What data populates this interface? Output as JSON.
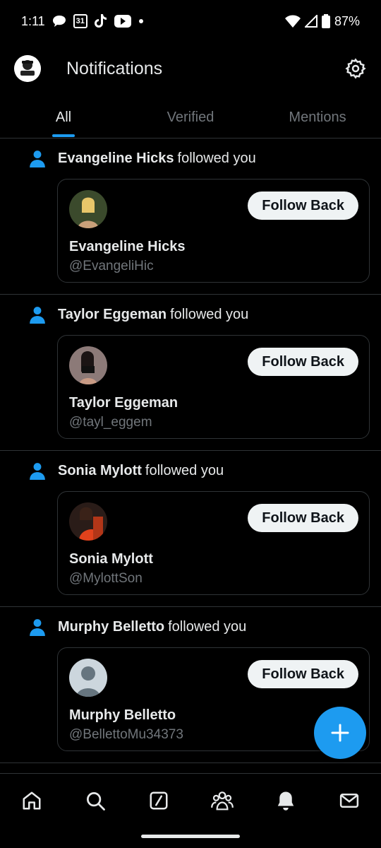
{
  "status_bar": {
    "time": "1:11",
    "battery": "87%",
    "calendar_day": "31",
    "left_icons": [
      "chat-bubble-icon",
      "calendar-icon",
      "tiktok-icon",
      "youtube-icon",
      "dot-icon"
    ],
    "right_icons": [
      "wifi-icon",
      "signal-icon",
      "battery-icon"
    ]
  },
  "header": {
    "title": "Notifications",
    "settings_icon": "gear-icon"
  },
  "tabs": [
    {
      "label": "All",
      "active": true
    },
    {
      "label": "Verified",
      "active": false
    },
    {
      "label": "Mentions",
      "active": false
    }
  ],
  "notifications": [
    {
      "name": "Evangeline Hicks",
      "action": "followed you",
      "card": {
        "name": "Evangeline Hicks",
        "handle": "@EvangeliHic",
        "button": "Follow Back"
      }
    },
    {
      "name": "Taylor Eggeman",
      "action": "followed you",
      "card": {
        "name": "Taylor Eggeman",
        "handle": "@tayl_eggem",
        "button": "Follow Back"
      }
    },
    {
      "name": "Sonia Mylott",
      "action": "followed you",
      "card": {
        "name": "Sonia Mylott",
        "handle": "@MylottSon",
        "button": "Follow Back"
      }
    },
    {
      "name": "Murphy Belletto",
      "action": "followed you",
      "card": {
        "name": "Murphy Belletto",
        "handle": "@BellettoMu34373",
        "button": "Follow Back"
      }
    }
  ],
  "fab": {
    "icon": "plus-icon"
  },
  "bottom_nav": {
    "items": [
      "home-icon",
      "search-icon",
      "grok-icon",
      "communities-icon",
      "notifications-bell-icon",
      "messages-icon"
    ]
  },
  "colors": {
    "accent": "#1d9bf0",
    "background": "#000000",
    "text_primary": "#e7e9ea",
    "text_secondary": "#71767b",
    "divider": "#2f3336"
  }
}
